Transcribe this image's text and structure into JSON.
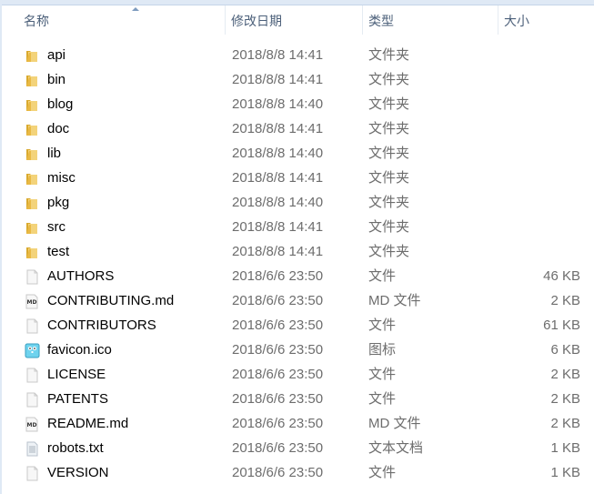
{
  "columns": {
    "name": "名称",
    "date": "修改日期",
    "type": "类型",
    "size": "大小"
  },
  "files": [
    {
      "name": "api",
      "date": "2018/8/8 14:41",
      "type": "文件夹",
      "size": "",
      "icon": "folder-icon"
    },
    {
      "name": "bin",
      "date": "2018/8/8 14:41",
      "type": "文件夹",
      "size": "",
      "icon": "folder-icon"
    },
    {
      "name": "blog",
      "date": "2018/8/8 14:40",
      "type": "文件夹",
      "size": "",
      "icon": "folder-icon"
    },
    {
      "name": "doc",
      "date": "2018/8/8 14:41",
      "type": "文件夹",
      "size": "",
      "icon": "folder-icon"
    },
    {
      "name": "lib",
      "date": "2018/8/8 14:40",
      "type": "文件夹",
      "size": "",
      "icon": "folder-icon"
    },
    {
      "name": "misc",
      "date": "2018/8/8 14:41",
      "type": "文件夹",
      "size": "",
      "icon": "folder-icon"
    },
    {
      "name": "pkg",
      "date": "2018/8/8 14:40",
      "type": "文件夹",
      "size": "",
      "icon": "folder-icon"
    },
    {
      "name": "src",
      "date": "2018/8/8 14:41",
      "type": "文件夹",
      "size": "",
      "icon": "folder-icon"
    },
    {
      "name": "test",
      "date": "2018/8/8 14:41",
      "type": "文件夹",
      "size": "",
      "icon": "folder-icon"
    },
    {
      "name": "AUTHORS",
      "date": "2018/6/6 23:50",
      "type": "文件",
      "size": "46 KB",
      "icon": "file-icon"
    },
    {
      "name": "CONTRIBUTING.md",
      "date": "2018/6/6 23:50",
      "type": "MD 文件",
      "size": "2 KB",
      "icon": "markdown-file-icon"
    },
    {
      "name": "CONTRIBUTORS",
      "date": "2018/6/6 23:50",
      "type": "文件",
      "size": "61 KB",
      "icon": "file-icon"
    },
    {
      "name": "favicon.ico",
      "date": "2018/6/6 23:50",
      "type": "图标",
      "size": "6 KB",
      "icon": "gopher-icon"
    },
    {
      "name": "LICENSE",
      "date": "2018/6/6 23:50",
      "type": "文件",
      "size": "2 KB",
      "icon": "file-icon"
    },
    {
      "name": "PATENTS",
      "date": "2018/6/6 23:50",
      "type": "文件",
      "size": "2 KB",
      "icon": "file-icon"
    },
    {
      "name": "README.md",
      "date": "2018/6/6 23:50",
      "type": "MD 文件",
      "size": "2 KB",
      "icon": "markdown-file-icon"
    },
    {
      "name": "robots.txt",
      "date": "2018/6/6 23:50",
      "type": "文本文档",
      "size": "1 KB",
      "icon": "text-file-icon"
    },
    {
      "name": "VERSION",
      "date": "2018/6/6 23:50",
      "type": "文件",
      "size": "1 KB",
      "icon": "file-icon"
    }
  ]
}
